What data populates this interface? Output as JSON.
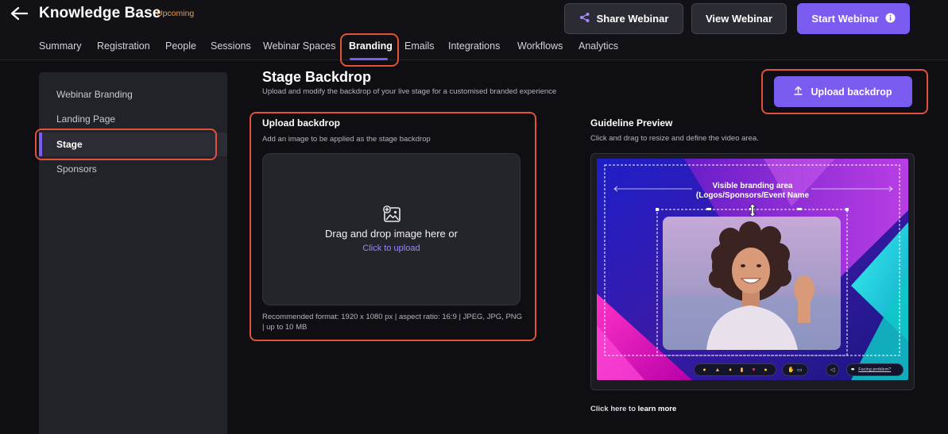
{
  "header": {
    "title": "Knowledge Base",
    "status_badge": "Upcoming",
    "share_label": "Share Webinar",
    "view_label": "View Webinar",
    "start_label": "Start Webinar"
  },
  "tabs": [
    {
      "label": "Summary"
    },
    {
      "label": "Registration"
    },
    {
      "label": "People"
    },
    {
      "label": "Sessions"
    },
    {
      "label": "Webinar Spaces"
    },
    {
      "label": "Branding",
      "active": true
    },
    {
      "label": "Emails"
    },
    {
      "label": "Integrations"
    },
    {
      "label": "Workflows"
    },
    {
      "label": "Analytics"
    }
  ],
  "sidebar": {
    "items": [
      {
        "label": "Webinar Branding"
      },
      {
        "label": "Landing Page"
      },
      {
        "label": "Stage",
        "active": true
      },
      {
        "label": "Sponsors"
      }
    ]
  },
  "main": {
    "title": "Stage Backdrop",
    "subtitle": "Upload and modify the backdrop of your live stage for a customised branded experience",
    "upload_button_label": "Upload backdrop",
    "upload_section": {
      "title": "Upload backdrop",
      "subtitle": "Add an image to be applied as the stage backdrop",
      "drop_text": "Drag and drop image here or",
      "click_text": "Click to upload",
      "note": "Recommended format: 1920 x 1080 px | aspect ratio: 16:9 | JPEG, JPG, PNG | up to 10 MB"
    },
    "guideline": {
      "title": "Guideline Preview",
      "subtitle": "Click and drag to resize and define the video area.",
      "visible_area_line1": "Visible branding area",
      "visible_area_line2": "(Logos/Sponsors/Event Name",
      "facing_problem": "Facing problem?"
    },
    "learn_prefix": "Click here to",
    "learn_link": "learn more"
  },
  "colors": {
    "accent": "#7a5cf0",
    "badge": "#f59a3b",
    "highlight": "#e1513c",
    "link": "#9a86ff"
  },
  "icons": {
    "back": "arrow-left-icon",
    "share": "share-icon",
    "info": "info-icon",
    "upload": "upload-icon",
    "image_add": "image-add-icon",
    "resize": "resize-vertical-icon"
  }
}
